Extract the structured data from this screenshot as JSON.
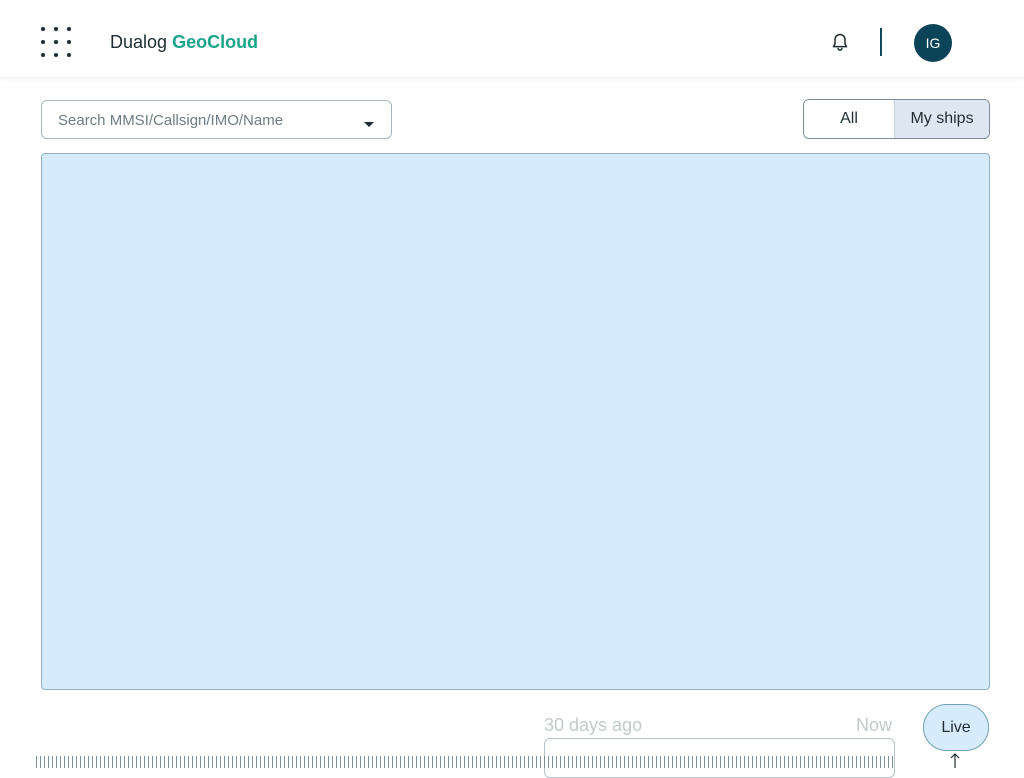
{
  "header": {
    "brand_name": "Dualog",
    "brand_product": "GeoCloud",
    "user_initials": "IG",
    "icons": {
      "apps": "apps-grid-icon",
      "notifications": "bell-icon"
    }
  },
  "search": {
    "placeholder": "Search MMSI/Callsign/IMO/Name",
    "value": "",
    "dropdown_icon": "caret-down-icon"
  },
  "ship_filter": {
    "options": [
      "All",
      "My ships"
    ],
    "selected": "My ships"
  },
  "map": {
    "background_color": "#d6ecfd"
  },
  "timeline": {
    "start_label": "30 days ago",
    "end_label": "Now",
    "live_label": "Live"
  },
  "colors": {
    "brand_accent": "#1aa58a",
    "avatar_bg": "#0b4459",
    "toggle_selected_bg": "#dde6f1"
  }
}
